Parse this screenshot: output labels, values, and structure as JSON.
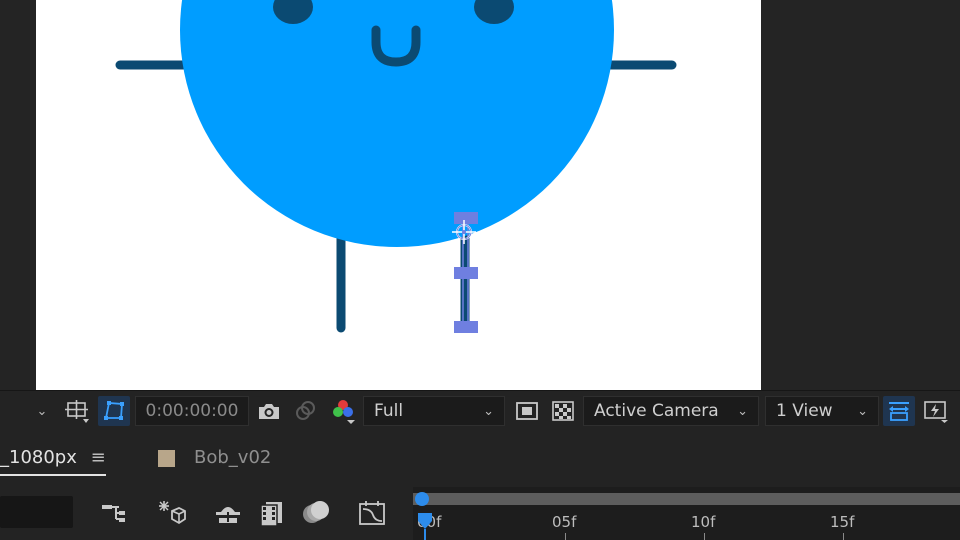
{
  "viewer": {
    "snapshot_time": "0:00:00:00",
    "resolution": "Full",
    "camera": "Active Camera",
    "view_layout": "1 View"
  },
  "timeline": {
    "tabs": [
      {
        "label": "_1080px",
        "active": true,
        "menu_icon": "hamburger-menu-icon"
      },
      {
        "label": "Bob_v02",
        "active": false,
        "swatch_color": "#b8a68a"
      }
    ],
    "ruler_labels": [
      "00f",
      "05f",
      "10f",
      "15f"
    ],
    "tools": [
      "comp-flowchart-icon",
      "draft-3d-icon",
      "shy-layers-icon",
      "frame-blending-icon",
      "motion-blur-icon",
      "graph-editor-icon"
    ]
  },
  "colors": {
    "character_body": "#009dff",
    "character_lines": "#0b4a72",
    "puppet_pins": "#6f7fe0",
    "accent": "#2d8ceb"
  }
}
